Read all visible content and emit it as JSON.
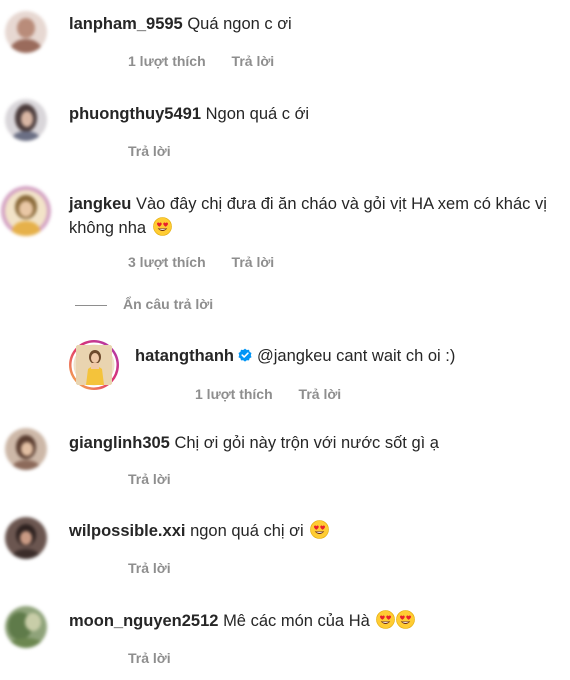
{
  "comments": [
    {
      "username": "lanpham_9595",
      "text": "Quá ngon c ơi",
      "likes": "1 lượt thích",
      "reply": "Trả lời",
      "emojis": 0
    },
    {
      "username": "phuongthuy5491",
      "text": "Ngon quá c ới",
      "likes": "",
      "reply": "Trả lời",
      "emojis": 0
    },
    {
      "username": "jangkeu",
      "text": "Vào đây chị đưa đi ăn cháo và gỏi vịt HA xem có khác vị không nha",
      "likes": "3 lượt thích",
      "reply": "Trả lời",
      "emojis": 1
    },
    {
      "username": "gianglinh305",
      "text": "Chị ơi gỏi này trộn với nước sốt gì ạ",
      "likes": "",
      "reply": "Trả lời",
      "emojis": 0
    },
    {
      "username": "wilpossible.xxi",
      "text": "ngon quá chị ơi",
      "likes": "",
      "reply": "Trả lời",
      "emojis": 1
    },
    {
      "username": "moon_nguyen2512",
      "text": "Mê các món của Hà",
      "likes": "",
      "reply": "Trả lời",
      "emojis": 2
    }
  ],
  "hide_replies_label": "Ẩn câu trả lời",
  "reply_comment": {
    "username": "hatangthanh",
    "verified": true,
    "text": "@jangkeu cant wait ch oi :)",
    "likes": "1 lượt thích",
    "reply": "Trả lời"
  },
  "colors": {
    "text": "#262626",
    "secondary": "#8e8e8e",
    "verified": "#0095f6",
    "story_ring": "#c13584"
  },
  "icons": {
    "emoji": "heart-eyes-emoji-icon",
    "verified": "verified-badge-icon"
  }
}
